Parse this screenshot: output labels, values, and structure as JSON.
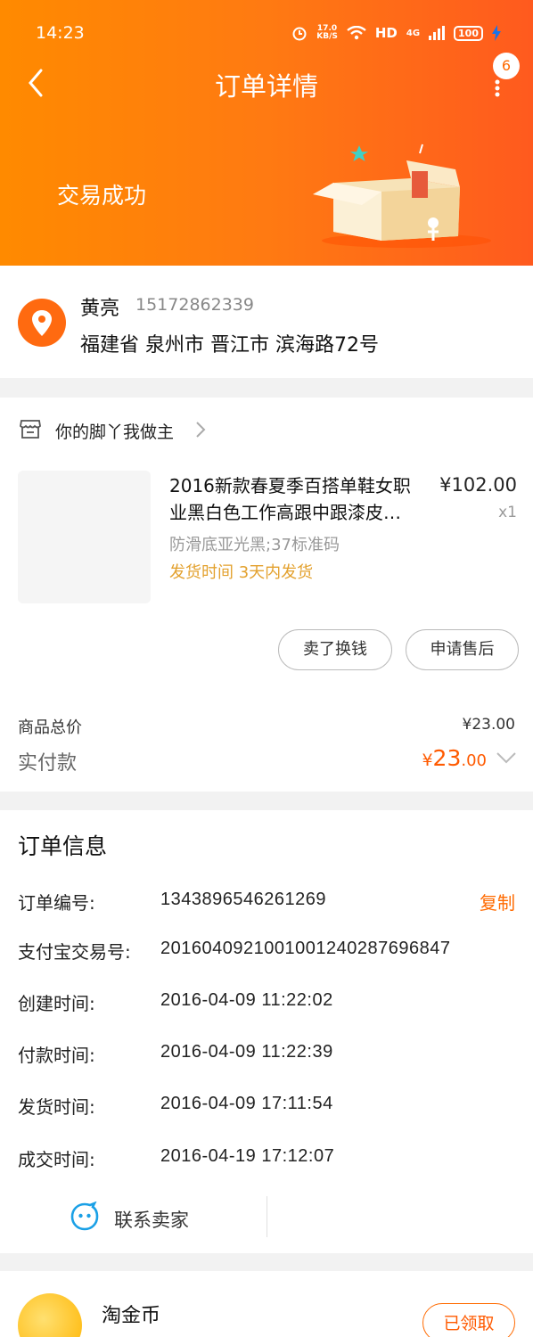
{
  "status_bar": {
    "time": "14:23",
    "speed_top": "17.0",
    "speed_bottom": "KB/S",
    "hd": "HD",
    "network": "4G",
    "battery": "100"
  },
  "nav": {
    "title": "订单详情",
    "badge_count": "6"
  },
  "banner": {
    "status": "交易成功"
  },
  "address": {
    "name": "黄亮",
    "phone": "15172862339",
    "full": "福建省 泉州市 晋江市 滨海路72号"
  },
  "shop": {
    "name": "你的脚丫我做主"
  },
  "product": {
    "title": "2016新款春夏季百搭单鞋女职业黑白色工作高跟中跟漆皮…",
    "price": "¥102.00",
    "quantity": "x1",
    "spec": "防滑底亚光黑;37标准码",
    "ship_time": "发货时间 3天内发货"
  },
  "actions": {
    "sell": "卖了换钱",
    "after_sale": "申请售后"
  },
  "totals": {
    "goods_total_label": "商品总价",
    "goods_total_value": "¥23.00",
    "paid_label": "实付款",
    "paid_symbol": "¥",
    "paid_int": "23",
    "paid_dec": ".00"
  },
  "order_info": {
    "title": "订单信息",
    "copy_label": "复制",
    "rows": [
      {
        "label": "订单编号:",
        "value": "1343896546261269"
      },
      {
        "label": "支付宝交易号:",
        "value": "2016040921001001240287696847"
      },
      {
        "label": "创建时间:",
        "value": "2016-04-09 11:22:02"
      },
      {
        "label": "付款时间:",
        "value": "2016-04-09 11:22:39"
      },
      {
        "label": "发货时间:",
        "value": "2016-04-09 17:11:54"
      },
      {
        "label": "成交时间:",
        "value": "2016-04-19 17:12:07"
      }
    ],
    "contact_label": "联系卖家"
  },
  "coin": {
    "label": "淘金币",
    "claimed_label": "已领取"
  },
  "colors": {
    "accent": "#ff6a00",
    "ship_time": "#e3a12e"
  }
}
